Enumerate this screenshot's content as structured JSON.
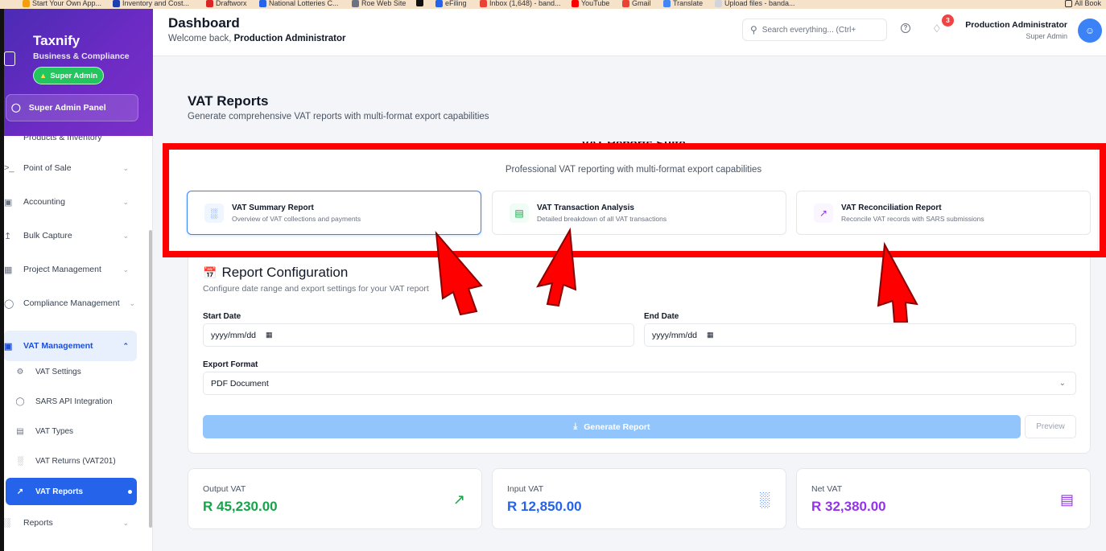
{
  "bookmarks": [
    "Start Your Own App...",
    "Inventory and Cost...",
    "Draftworx",
    "National Lotteries C...",
    "Roe Web Site",
    "eFiling",
    "Inbox (1,648) - band...",
    "YouTube",
    "Gmail",
    "Translate",
    "Upload files - banda...",
    "All Book"
  ],
  "sidebar": {
    "brand_title": "Taxnify",
    "brand_sub": "Business & Compliance",
    "badge": "Super Admin",
    "panel": "Super Admin Panel",
    "partial_item": "Products & Inventory",
    "items": [
      {
        "label": "Point of Sale"
      },
      {
        "label": "Accounting"
      },
      {
        "label": "Bulk Capture"
      },
      {
        "label": "Project Management"
      },
      {
        "label": "Compliance Management"
      },
      {
        "label": "VAT Management"
      }
    ],
    "sub_items": [
      {
        "label": "VAT Settings"
      },
      {
        "label": "SARS API Integration"
      },
      {
        "label": "VAT Types"
      },
      {
        "label": "VAT Returns (VAT201)"
      },
      {
        "label": "VAT Reports"
      }
    ],
    "reports": "Reports"
  },
  "header": {
    "title": "Dashboard",
    "welcome": "Welcome back, ",
    "user_bold": "Production Administrator",
    "search_placeholder": "Search everything... (Ctrl+",
    "notification_count": "3",
    "user_name": "Production Administrator",
    "user_role": "Super Admin"
  },
  "main": {
    "title": "VAT Reports",
    "subtitle": "Generate comprehensive VAT reports with multi-format export capabilities",
    "suite_title": "VAT Reports Suite",
    "suite_sub": "Professional VAT reporting with multi-format export capabilities",
    "reports": [
      {
        "name": "VAT Summary Report",
        "desc": "Overview of VAT collections and payments"
      },
      {
        "name": "VAT Transaction Analysis",
        "desc": "Detailed breakdown of all VAT transactions"
      },
      {
        "name": "VAT Reconciliation Report",
        "desc": "Reconcile VAT records with SARS submissions"
      }
    ],
    "config": {
      "title": "Report Configuration",
      "subtitle": "Configure date range and export settings for your VAT report",
      "start_label": "Start Date",
      "start_value": "yyyy/mm/dd",
      "end_label": "End Date",
      "end_value": "yyyy/mm/dd",
      "format_label": "Export Format",
      "format_value": "PDF Document",
      "generate": "Generate Report",
      "preview": "Preview"
    },
    "stats": [
      {
        "label": "Output VAT",
        "value": "R 45,230.00",
        "color": "#16a34a"
      },
      {
        "label": "Input VAT",
        "value": "R 12,850.00",
        "color": "#2563eb"
      },
      {
        "label": "Net VAT",
        "value": "R 32,380.00",
        "color": "#9333ea"
      }
    ]
  },
  "annotation_color": "#ff0000"
}
